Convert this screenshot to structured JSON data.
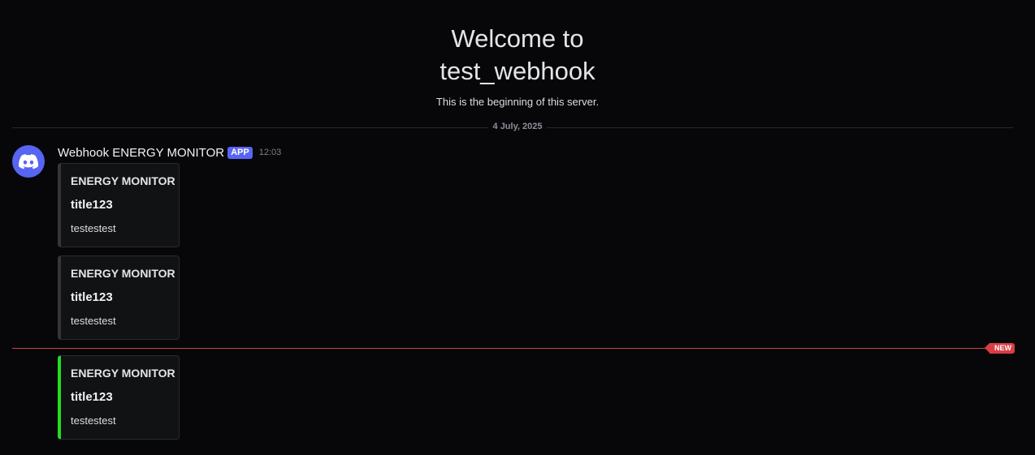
{
  "welcome": {
    "title": "Welcome to test_webhook",
    "subtitle": "This is the beginning of this server."
  },
  "date_divider": {
    "label": "4 July, 2025"
  },
  "message": {
    "author": "Webhook ENERGY MONITOR",
    "badge": "APP",
    "timestamp": "12:03",
    "avatar_icon": "discord-logo-icon",
    "embeds": [
      {
        "author": "ENERGY MONITOR",
        "title": "title123",
        "description": "testestest",
        "color": "#35363c"
      },
      {
        "author": "ENERGY MONITOR",
        "title": "title123",
        "description": "testestest",
        "color": "#35363c"
      },
      {
        "author": "ENERGY MONITOR",
        "title": "title123",
        "description": "testestest",
        "color": "#22dd22"
      }
    ]
  },
  "new_divider": {
    "label": "NEW",
    "color": "#da3e44"
  },
  "colors": {
    "background": "#07070a",
    "accent": "#5865f2"
  }
}
